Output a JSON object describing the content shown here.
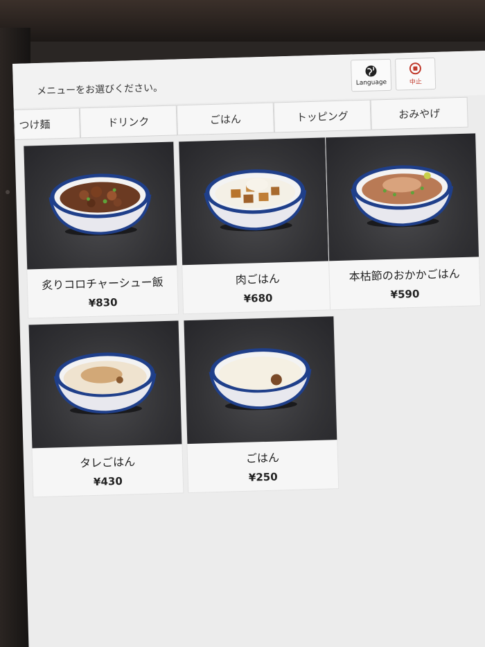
{
  "header": {
    "prompt": "メニューをお選びください。",
    "language_label": "Language",
    "stop_label": "中止"
  },
  "tabs": [
    "つけ麺",
    "ドリンク",
    "ごはん",
    "トッピング",
    "おみやげ"
  ],
  "items": [
    {
      "name": "炙りコロチャーシュー飯",
      "price": "¥830",
      "topping": "chashu"
    },
    {
      "name": "肉ごはん",
      "price": "¥680",
      "topping": "meat"
    },
    {
      "name": "本枯節のおかかごはん",
      "price": "¥590",
      "topping": "okaka"
    },
    {
      "name": "タレごはん",
      "price": "¥430",
      "topping": "tare"
    },
    {
      "name": "ごはん",
      "price": "¥250",
      "topping": "plain"
    }
  ],
  "colors": {
    "screen_bg": "#ececec",
    "stop_red": "#c0392b",
    "bowl_blue": "#1f3f8a"
  }
}
